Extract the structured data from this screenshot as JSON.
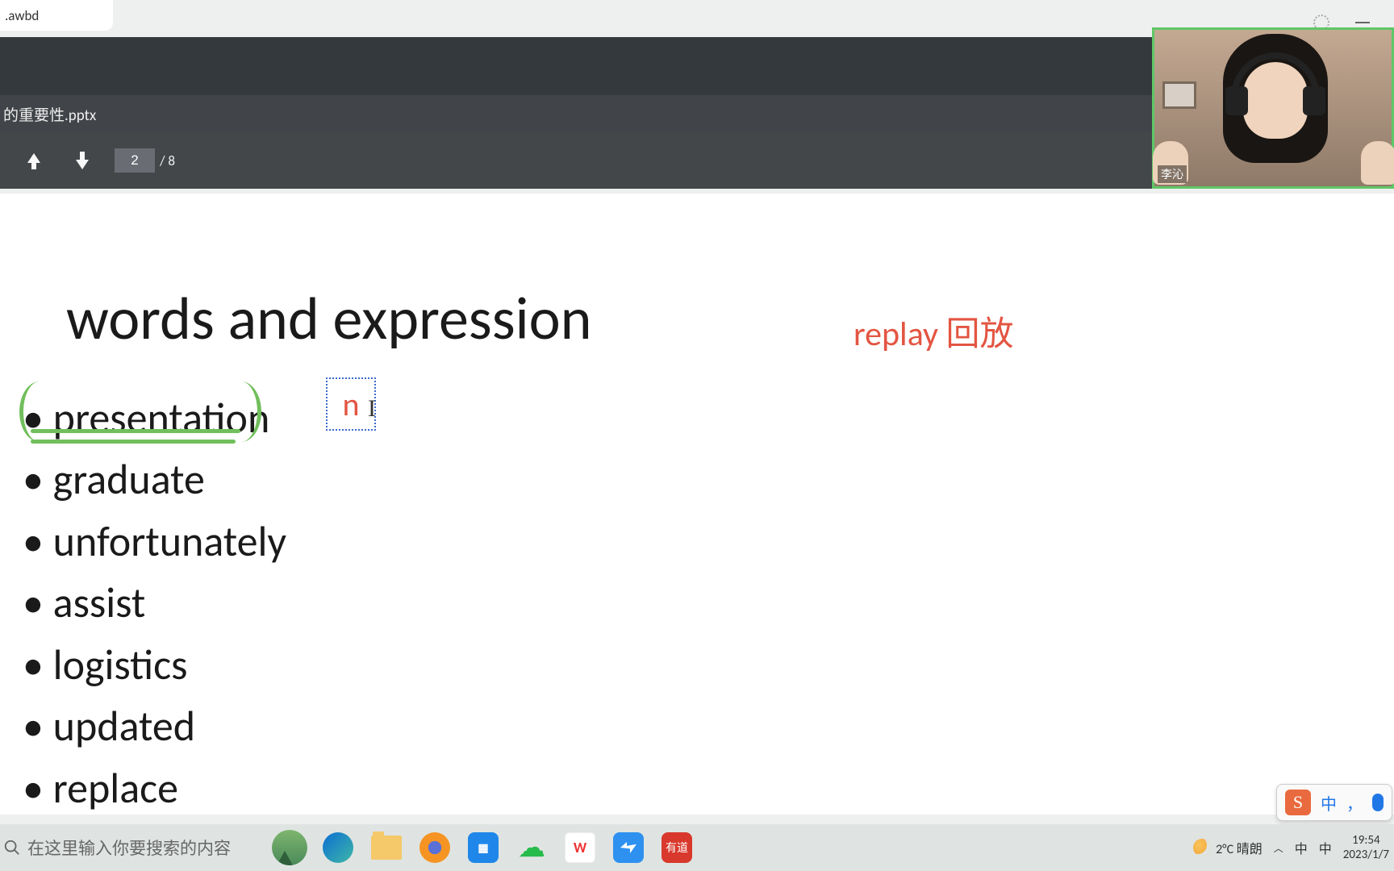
{
  "tab": {
    "label": ".awbd"
  },
  "bar2": {
    "filename": "的重要性.pptx"
  },
  "pager": {
    "current": "2",
    "total": "/ 8"
  },
  "webcam": {
    "name_tag": "李沁"
  },
  "slide": {
    "title": "words and expression",
    "replay": "replay 回放",
    "annotation_letter": "n",
    "items": [
      "presentation",
      "graduate",
      "unfortunately",
      "assist",
      "logistics",
      "updated",
      "replace"
    ]
  },
  "taskbar": {
    "search_placeholder": "在这里输入你要搜索的内容",
    "weather": "2°C 晴朗",
    "tray_ime1": "中",
    "tray_ime2": "中",
    "time": "19:54",
    "date": "2023/1/7"
  },
  "ime": {
    "lang": "中",
    "comma": "，"
  },
  "taskbar_apps": {
    "tencent_meeting": "▦",
    "wps": "W",
    "youdao": "有道"
  }
}
